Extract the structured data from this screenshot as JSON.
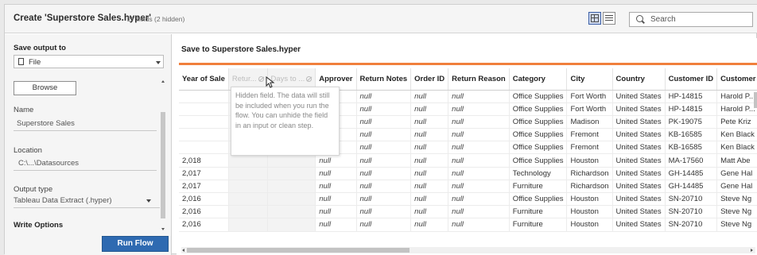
{
  "topbar": {
    "title": "Create 'Superstore Sales.hyper'",
    "fields_info": "27 fields (2 hidden)",
    "search_placeholder": "Search"
  },
  "left_panel": {
    "save_output_to_label": "Save output to",
    "save_output_to_value": "File",
    "browse_label": "Browse",
    "name_label": "Name",
    "name_value": "Superstore Sales",
    "location_label": "Location",
    "location_value": "C:\\...\\Datasources",
    "output_type_label": "Output type",
    "output_type_value": "Tableau Data Extract (.hyper)",
    "write_options_label": "Write Options",
    "run_flow_label": "Run Flow"
  },
  "right_panel": {
    "title": "Save to Superstore Sales.hyper",
    "tooltip": "Hidden field. The data will still be included when you run the flow. You can unhide the field in an input or clean step."
  },
  "table": {
    "columns": [
      "Year of Sale",
      "Retur...",
      "Days to ...",
      "Approver",
      "Return Notes",
      "Order ID",
      "Return Reason",
      "Category",
      "City",
      "Country",
      "Customer ID",
      "Customer"
    ],
    "rows": [
      [
        "",
        "",
        "",
        "null",
        "null",
        "null",
        "null",
        "Office Supplies",
        "Fort Worth",
        "United States",
        "HP-14815",
        "Harold P..."
      ],
      [
        "",
        "",
        "",
        "null",
        "null",
        "null",
        "null",
        "Office Supplies",
        "Fort Worth",
        "United States",
        "HP-14815",
        "Harold P..."
      ],
      [
        "",
        "",
        "",
        "null",
        "null",
        "null",
        "null",
        "Office Supplies",
        "Madison",
        "United States",
        "PK-19075",
        "Pete Kriz"
      ],
      [
        "",
        "",
        "",
        "null",
        "null",
        "null",
        "null",
        "Office Supplies",
        "Fremont",
        "United States",
        "KB-16585",
        "Ken Black"
      ],
      [
        "",
        "",
        "",
        "null",
        "null",
        "null",
        "null",
        "Office Supplies",
        "Fremont",
        "United States",
        "KB-16585",
        "Ken Black"
      ],
      [
        "2,018",
        "",
        "",
        "null",
        "null",
        "null",
        "null",
        "Office Supplies",
        "Houston",
        "United States",
        "MA-17560",
        "Matt Abe"
      ],
      [
        "2,017",
        "",
        "",
        "null",
        "null",
        "null",
        "null",
        "Technology",
        "Richardson",
        "United States",
        "GH-14485",
        "Gene Hal"
      ],
      [
        "2,017",
        "",
        "",
        "null",
        "null",
        "null",
        "null",
        "Furniture",
        "Richardson",
        "United States",
        "GH-14485",
        "Gene Hal"
      ],
      [
        "2,016",
        "",
        "",
        "null",
        "null",
        "null",
        "null",
        "Office Supplies",
        "Houston",
        "United States",
        "SN-20710",
        "Steve Ng"
      ],
      [
        "2,016",
        "",
        "",
        "null",
        "null",
        "null",
        "null",
        "Furniture",
        "Houston",
        "United States",
        "SN-20710",
        "Steve Ng"
      ],
      [
        "2,016",
        "",
        "",
        "null",
        "null",
        "null",
        "null",
        "Furniture",
        "Houston",
        "United States",
        "SN-20710",
        "Steve Ng"
      ]
    ]
  },
  "colors": {
    "accent_orange": "#f07f3c",
    "run_button_blue": "#2e6ab1"
  }
}
